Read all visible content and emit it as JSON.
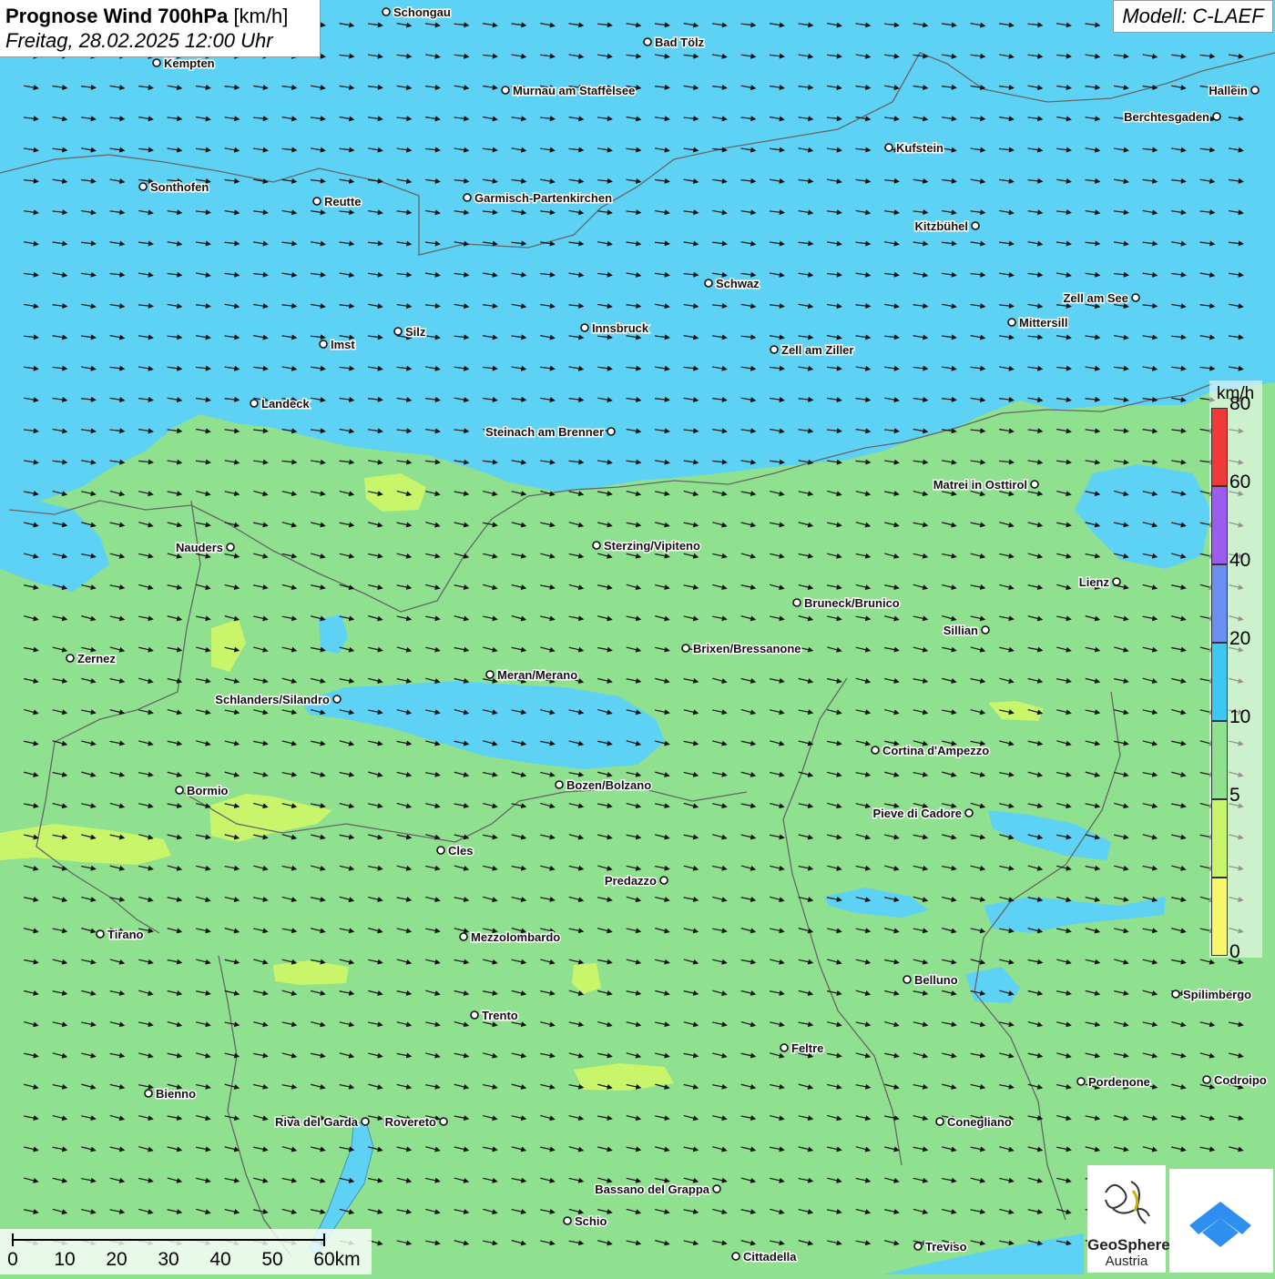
{
  "title": {
    "main": "Prognose Wind 700hPa",
    "unit": "[km/h]",
    "date": "Freitag, 28.02.2025 12:00 Uhr"
  },
  "model": "Modell: C-LAEF",
  "legend": {
    "unit": "km/h",
    "classes": [
      {
        "from": 0,
        "to": 5,
        "color": "#f7f76b"
      },
      {
        "from": 5,
        "to": 10,
        "color": "#c9f56b"
      },
      {
        "from": 10,
        "to": 20,
        "color": "#8fe08f"
      },
      {
        "from": 20,
        "to": 40,
        "color": "#3cc8f0"
      },
      {
        "from": 40,
        "to": 60,
        "color": "#6a8ff0"
      },
      {
        "from": 60,
        "to": 80,
        "color": "#9b5cf0"
      },
      {
        "from": 80,
        "to": 100,
        "color": "#f03a3a"
      }
    ],
    "ticks": [
      "0",
      "5",
      "10",
      "20",
      "40",
      "60",
      "80"
    ]
  },
  "scale_bar": {
    "labels": [
      "0",
      "10",
      "20",
      "30",
      "40",
      "50",
      "60km"
    ]
  },
  "logo": {
    "line1": "GeoSphere",
    "line2": "Austria"
  },
  "wind_arrows": {
    "direction": "east-southeast",
    "color": "#111111"
  },
  "cities": [
    {
      "name": "Schongau",
      "side": "right"
    },
    {
      "name": "Bad Tölz",
      "side": "right"
    },
    {
      "name": "Kempten",
      "side": "right"
    },
    {
      "name": "Murnau am Staffelsee",
      "side": "right"
    },
    {
      "name": "Hallein",
      "side": "left"
    },
    {
      "name": "Berchtesgaden",
      "side": "left"
    },
    {
      "name": "Kufstein",
      "side": "right"
    },
    {
      "name": "Sonthofen",
      "side": "right"
    },
    {
      "name": "Reutte",
      "side": "right"
    },
    {
      "name": "Garmisch-Partenkirchen",
      "side": "right"
    },
    {
      "name": "Kitzbühel",
      "side": "left"
    },
    {
      "name": "Schwaz",
      "side": "right"
    },
    {
      "name": "Zell am See",
      "side": "left"
    },
    {
      "name": "Mittersill",
      "side": "right"
    },
    {
      "name": "Innsbruck",
      "side": "right"
    },
    {
      "name": "Silz",
      "side": "right"
    },
    {
      "name": "Imst",
      "side": "right"
    },
    {
      "name": "Zell am Ziller",
      "side": "right"
    },
    {
      "name": "Landeck",
      "side": "right"
    },
    {
      "name": "Steinach am Brenner",
      "side": "left"
    },
    {
      "name": "Matrei in Osttirol",
      "side": "left"
    },
    {
      "name": "Nauders",
      "side": "left"
    },
    {
      "name": "Sterzing/Vipiteno",
      "side": "right"
    },
    {
      "name": "Lienz",
      "side": "left"
    },
    {
      "name": "Bruneck/Brunico",
      "side": "right"
    },
    {
      "name": "Sillian",
      "side": "left"
    },
    {
      "name": "Brixen/Bressanone",
      "side": "right"
    },
    {
      "name": "Zernez",
      "side": "right"
    },
    {
      "name": "Meran/Merano",
      "side": "right"
    },
    {
      "name": "Schlanders/Silandro",
      "side": "left"
    },
    {
      "name": "Cortina d'Ampezzo",
      "side": "right"
    },
    {
      "name": "Bozen/Bolzano",
      "side": "right"
    },
    {
      "name": "Bormio",
      "side": "right"
    },
    {
      "name": "Pieve di Cadore",
      "side": "left"
    },
    {
      "name": "Cles",
      "side": "right"
    },
    {
      "name": "Predazzo",
      "side": "left"
    },
    {
      "name": "Tirano",
      "side": "right"
    },
    {
      "name": "Mezzolombardo",
      "side": "right"
    },
    {
      "name": "Belluno",
      "side": "right"
    },
    {
      "name": "Spilimbergo",
      "side": "right"
    },
    {
      "name": "Trento",
      "side": "right"
    },
    {
      "name": "Feltre",
      "side": "right"
    },
    {
      "name": "Pordenone",
      "side": "right"
    },
    {
      "name": "Codroipo",
      "side": "right"
    },
    {
      "name": "Bienno",
      "side": "right"
    },
    {
      "name": "Riva del Garda",
      "side": "left"
    },
    {
      "name": "Rovereto",
      "side": "left"
    },
    {
      "name": "Conegliano",
      "side": "right"
    },
    {
      "name": "Bassano del Grappa",
      "side": "left"
    },
    {
      "name": "Schio",
      "side": "right"
    },
    {
      "name": "Treviso",
      "side": "right"
    },
    {
      "name": "Cittadella",
      "side": "right"
    }
  ]
}
